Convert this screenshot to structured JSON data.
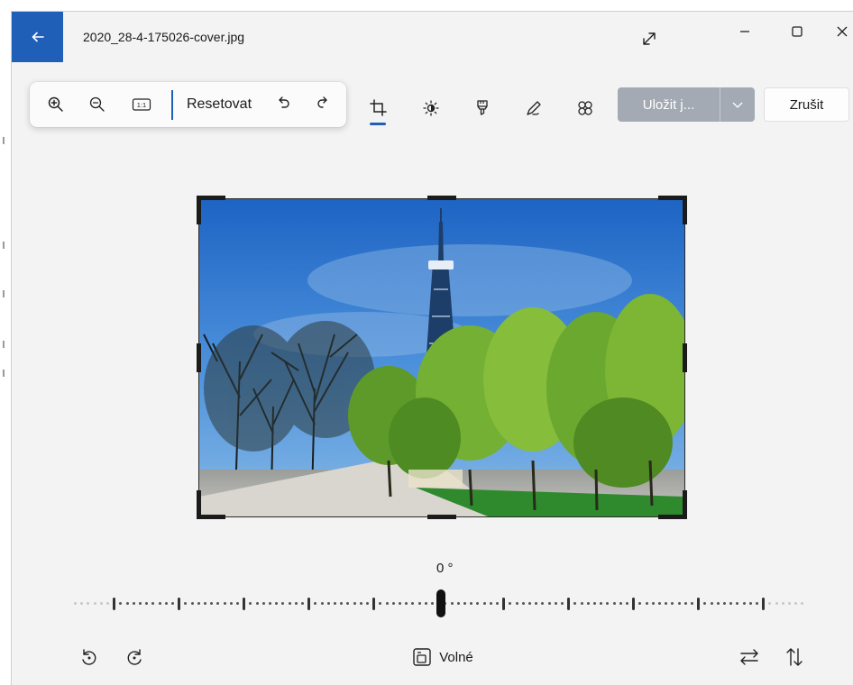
{
  "window": {
    "title": "2020_28-4-175026-cover.jpg",
    "accent": "#1f5fb8"
  },
  "titlebar": {
    "back_icon": "arrow-left-icon",
    "expand_icon": "expand-diagonal-icon",
    "minimize_icon": "minimize-icon",
    "maximize_icon": "maximize-icon",
    "close_icon": "close-icon"
  },
  "toolbar": {
    "zoom_in_icon": "zoom-in-icon",
    "zoom_out_icon": "zoom-out-icon",
    "actual_size_icon": "actual-size-icon",
    "actual_size_text": "1:1",
    "reset_label": "Resetovat",
    "undo_icon": "undo-icon",
    "redo_icon": "redo-icon",
    "tools": [
      {
        "name": "crop",
        "icon": "crop-icon",
        "active": true
      },
      {
        "name": "adjust",
        "icon": "brightness-icon",
        "active": false
      },
      {
        "name": "filter",
        "icon": "filter-icon",
        "active": false
      },
      {
        "name": "markup",
        "icon": "pen-icon",
        "active": false
      },
      {
        "name": "erase",
        "icon": "retouch-icon",
        "active": false
      }
    ],
    "save_label": "Uložit j...",
    "save_dropdown_icon": "chevron-down-icon",
    "cancel_label": "Zrušit"
  },
  "canvas": {
    "image_description_icon": "photo",
    "rotation_label": "0 °",
    "rotation_value_degrees": 0
  },
  "bottombar": {
    "rotate_left_icon": "rotate-left-icon",
    "rotate_right_icon": "rotate-right-icon",
    "aspect_icon": "aspect-ratio-icon",
    "aspect_label": "Volné",
    "flip_horizontal_icon": "flip-horizontal-icon",
    "flip_vertical_icon": "flip-vertical-icon"
  }
}
